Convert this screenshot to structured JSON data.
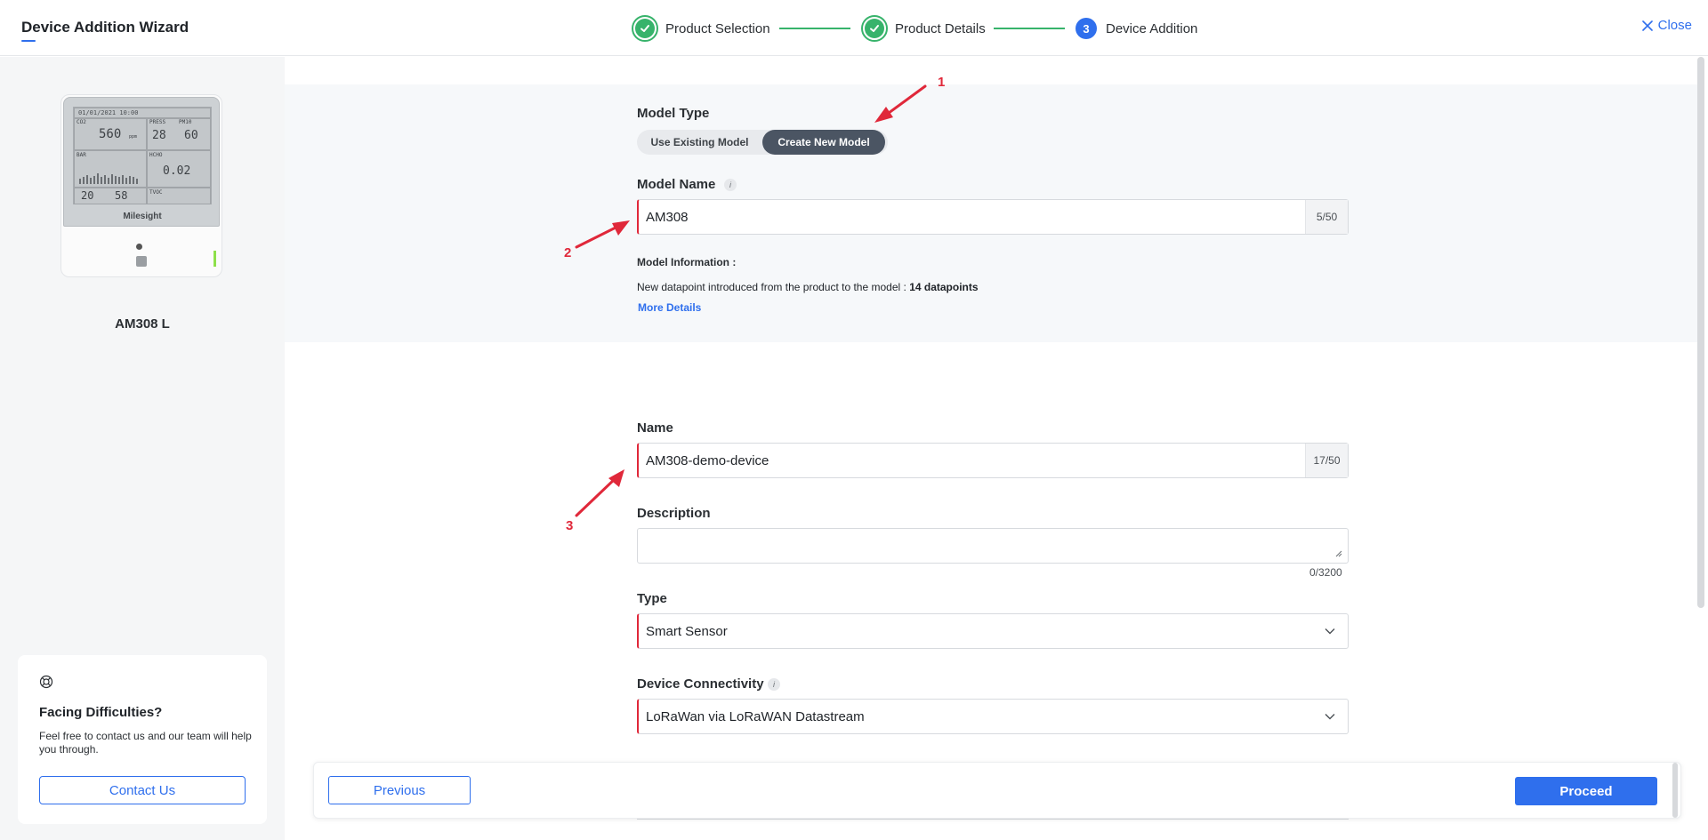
{
  "header": {
    "title": "Device Addition Wizard",
    "steps": [
      {
        "label": "Product Selection",
        "status": "done"
      },
      {
        "label": "Product Details",
        "status": "done"
      },
      {
        "label": "Device Addition",
        "number": "3",
        "status": "active"
      }
    ],
    "close_label": "Close"
  },
  "sidebar": {
    "device_name": "AM308 L",
    "device_brand": "Milesight",
    "lcd": {
      "date": "01/01/2021",
      "time": "10:00",
      "co2": "560",
      "co2_label": "CO2",
      "co2_unit": "ppm",
      "press": "28",
      "press_label": "PRESS",
      "pm": "60",
      "pm_label": "PM10",
      "tvoc_label": "HCHO",
      "tvoc": "0.02",
      "temp": "20",
      "hum": "58",
      "tvoc2_label": "TVOC",
      "bar_label": "BAR"
    },
    "help": {
      "title": "Facing Difficulties?",
      "text": "Feel free to contact us and our team will help you through.",
      "contact_label": "Contact Us"
    }
  },
  "form": {
    "model_type_label": "Model Type",
    "model_type_options": [
      "Use Existing Model",
      "Create New Model"
    ],
    "model_type_selected": "Create New Model",
    "model_name_label": "Model Name",
    "model_name_value": "AM308",
    "model_name_count": "5/50",
    "model_info_label": "Model Information :",
    "model_info_text": "New datapoint introduced from the product to the model :",
    "model_info_count": "14 datapoints",
    "more_details_label": "More Details",
    "name_label": "Name",
    "name_value": "AM308-demo-device",
    "name_count": "17/50",
    "description_label": "Description",
    "description_value": "",
    "description_count": "0/3200",
    "type_label": "Type",
    "type_value": "Smart Sensor",
    "connectivity_label": "Device Connectivity",
    "connectivity_value": "LoRaWan via LoRaWAN Datastream",
    "info_glyph": "i"
  },
  "footer": {
    "previous_label": "Previous",
    "proceed_label": "Proceed"
  },
  "annotations": [
    "1",
    "2",
    "3"
  ],
  "colors": {
    "accent": "#2f6fed",
    "success": "#37b36b",
    "error": "#e0283a",
    "segment_active": "#4b5563"
  }
}
